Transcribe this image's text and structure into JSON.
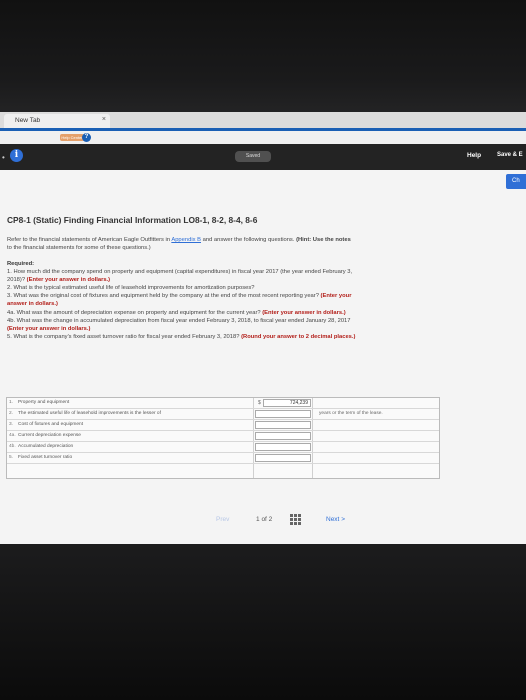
{
  "browser": {
    "tab_title": "New Tab",
    "tab_close": "×",
    "help_center_label": "Help Center",
    "help_badge": "?"
  },
  "toolbar": {
    "saved_label": "Saved",
    "help_label": "Help",
    "save_exit_label": "Save & E",
    "check_label": "Ch",
    "info_symbol": "i",
    "dot": "•"
  },
  "problem": {
    "title": "CP8-1 (Static) Finding Financial Information LO8-1, 8-2, 8-4, 8-6",
    "intro_pre": "Refer to the financial statements of American Eagle Outfitters in ",
    "intro_link": "Appendix B",
    "intro_post": " and answer the following questions. ",
    "intro_hint_label": "(Hint: Use the notes",
    "intro_line2": "to the financial statements for some of these questions.)",
    "required_label": "Required:",
    "q1a": "1. How much did the company spend on property and equipment (capital expenditures) in fiscal year 2017 (the year ended February 3,",
    "q1b": "2018)? ",
    "q1_instr": "(Enter your answer in dollars.)",
    "q2": "2. What is the typical estimated useful life of leasehold improvements for amortization purposes?",
    "q3": "3. What was the original cost of fixtures and equipment held by the company at the end of the most recent reporting year? ",
    "q3_instr_a": "(Enter your",
    "q3_instr_b": "answer in dollars.)",
    "q4a": "4a. What was the amount of depreciation expense on property and equipment for the current year? ",
    "q4a_instr": "(Enter your answer in dollars.)",
    "q4b": "4b. What was the change in accumulated depreciation from fiscal year ended February 3, 2018, to fiscal year ended January 28, 2017",
    "q4b_instr": "(Enter your answer in dollars.)",
    "q5": "5. What is the company's fixed asset turnover ratio for fiscal year ended February 3, 2018? ",
    "q5_instr": "(Round your answer to 2 decimal places.)"
  },
  "answer_rows": [
    {
      "num": "1.",
      "label": "Property and equipment",
      "currency": "$",
      "value": "724,239",
      "unit": ""
    },
    {
      "num": "2.",
      "label": "The estimated useful life of leasehold improvements is the lesser of",
      "currency": "",
      "value": "",
      "unit": "years or the term of the lease."
    },
    {
      "num": "3.",
      "label": "Cost of fixtures and equipment",
      "currency": "",
      "value": "",
      "unit": ""
    },
    {
      "num": "4a.",
      "label": "Current depreciation expense",
      "currency": "",
      "value": "",
      "unit": ""
    },
    {
      "num": "4b.",
      "label": "Accumulated depreciation",
      "currency": "",
      "value": "",
      "unit": ""
    },
    {
      "num": "5.",
      "label": "Fixed asset turnover ratio",
      "currency": "",
      "value": "",
      "unit": ""
    }
  ],
  "pager": {
    "prev_label": "Prev",
    "page_current": "1",
    "page_of": "of",
    "page_total": "2",
    "next_label": "Next",
    "next_chevron": ">"
  }
}
